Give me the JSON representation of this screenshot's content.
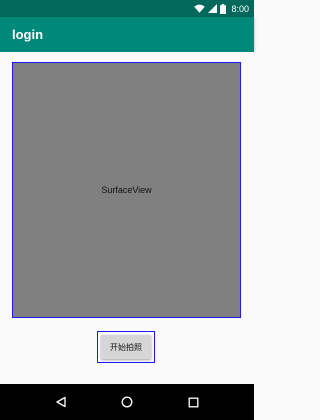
{
  "status_bar": {
    "time": "8:00",
    "icons": [
      "wifi-icon",
      "signal-icon",
      "battery-icon"
    ]
  },
  "app_bar": {
    "title": "login"
  },
  "main": {
    "surface_view_label": "SurfaceView",
    "capture_button_label": "开始拍照"
  },
  "nav_bar": {
    "icons": [
      "back-icon",
      "home-icon",
      "recents-icon"
    ]
  },
  "colors": {
    "status_bar": "#00695c",
    "app_bar": "#00897b",
    "surface_view": "#808080",
    "outline": "#1a1aff",
    "nav_bar": "#000000"
  }
}
